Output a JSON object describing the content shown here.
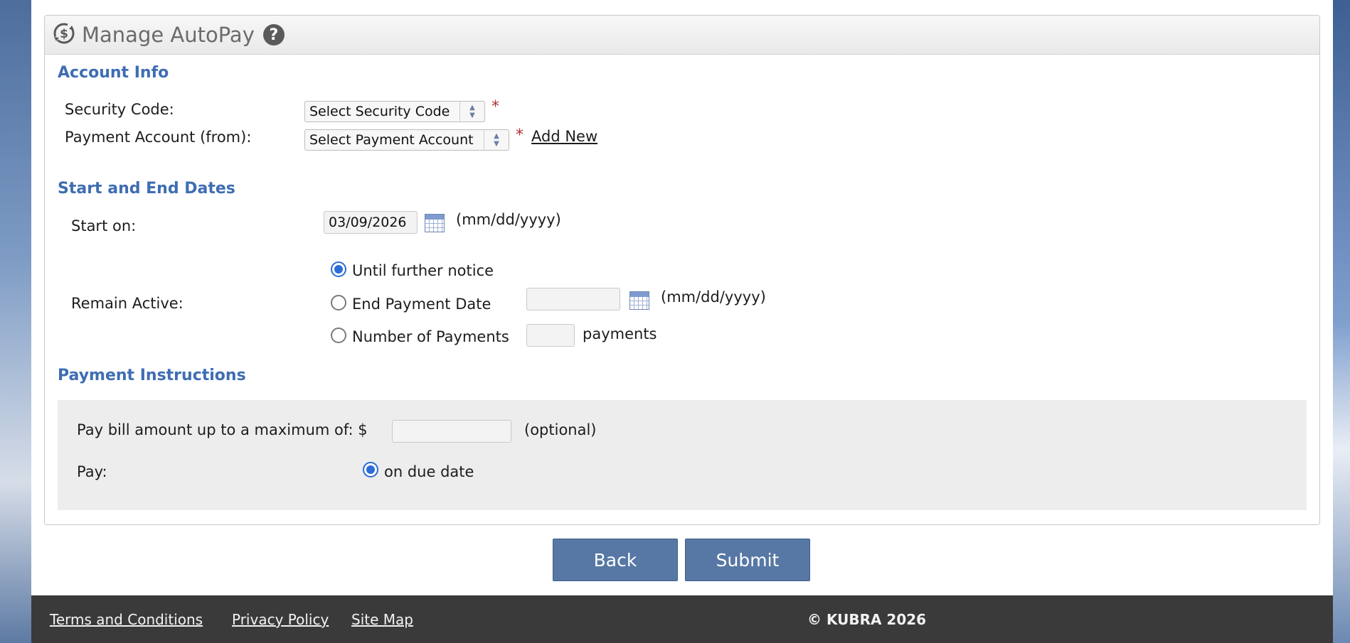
{
  "panel": {
    "title": "Manage AutoPay",
    "help_icon": "?",
    "icon": "autopay-dollar-sync-icon"
  },
  "account_info": {
    "heading": "Account Info",
    "security_code_label": "Security Code:",
    "security_code_value": "Select Security Code",
    "payment_account_label": "Payment Account (from):",
    "payment_account_value": "Select Payment Account",
    "required_mark": "*",
    "add_new_link": "Add New"
  },
  "dates": {
    "heading": "Start and End Dates",
    "start_label": "Start on:",
    "start_value": "03/09/2026",
    "date_format": "(mm/dd/yyyy)",
    "remain_active_label": "Remain Active:",
    "options": [
      {
        "label": "Until further notice",
        "selected": true
      },
      {
        "label": "End Payment Date",
        "selected": false
      },
      {
        "label": "Number of Payments",
        "selected": false
      }
    ],
    "end_date_value": "",
    "num_payments_value": "",
    "payments_suffix": "payments"
  },
  "instructions": {
    "heading": "Payment Instructions",
    "max_amount_label": "Pay bill amount up to a maximum of: $",
    "max_amount_value": "",
    "optional_text": "(optional)",
    "pay_label": "Pay:",
    "pay_option": "on due date",
    "pay_option_selected": true
  },
  "buttons": {
    "back": "Back",
    "submit": "Submit"
  },
  "footer": {
    "links": [
      "Terms and Conditions",
      "Privacy Policy",
      "Site Map"
    ],
    "copyright": "© KUBRA 2026"
  },
  "colors": {
    "accent": "#3e6db3",
    "button": "#5778a4",
    "footer_bg": "#3a3a3a",
    "radio_selected": "#2d6cd8"
  }
}
